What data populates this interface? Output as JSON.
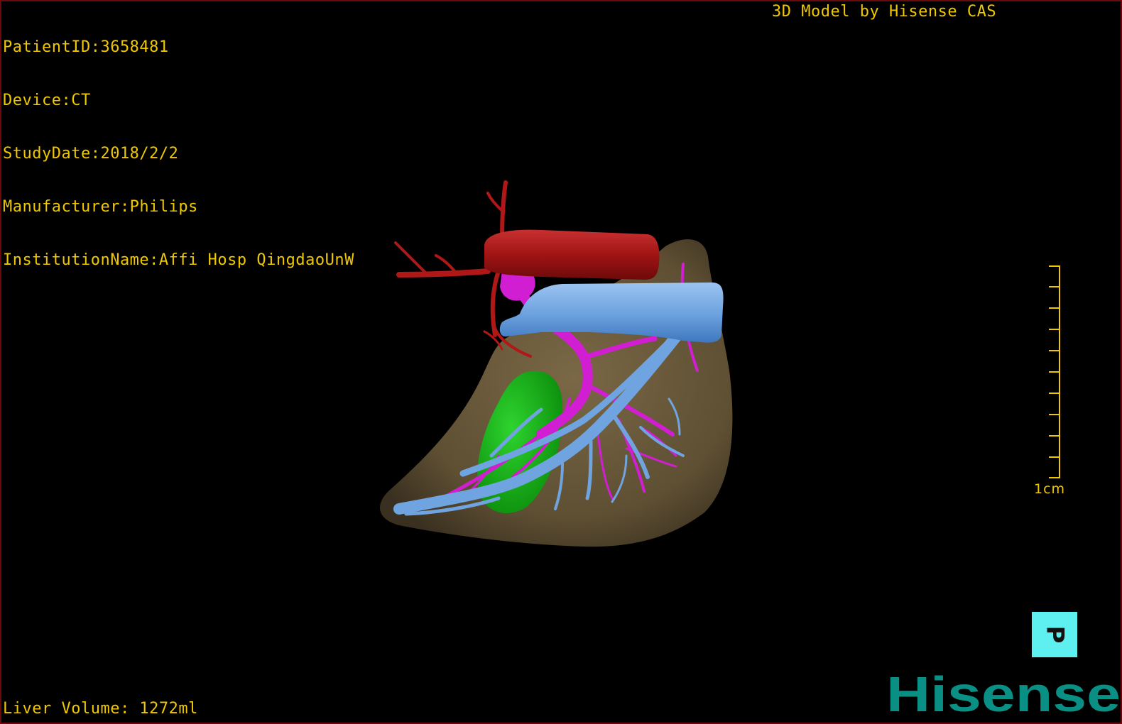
{
  "info": {
    "patient_id": "PatientID:3658481",
    "device": "Device:CT",
    "study_date": "StudyDate:2018/2/2",
    "manufacturer": "Manufacturer:Philips",
    "institution": "InstitutionName:Affi Hosp QingdaoUnW"
  },
  "model_credit": "3D Model by Hisense CAS",
  "scale": {
    "label": "1cm",
    "color": "#f0c800"
  },
  "orientation": {
    "label": "P",
    "color": "#5ef0f0"
  },
  "liver_volume": "Liver Volume: 1272ml",
  "brand": {
    "name": "Hisense",
    "color": "#0a8f84"
  },
  "model_colors": {
    "liver": "#6b5a3c",
    "artery": "#b01818",
    "portal_vein": "#d21ed2",
    "hepatic_vein": "#6fa4e0",
    "gallbladder": "#16b21a"
  }
}
